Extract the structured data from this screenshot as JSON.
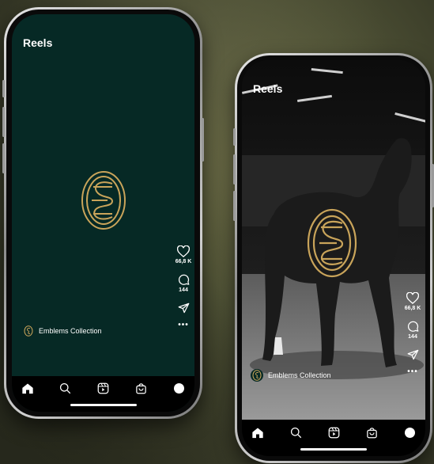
{
  "reel_left": {
    "title": "Reels",
    "likes": "66,8 K",
    "comments": "144",
    "account_name": "Emblems Collection",
    "more": "•••"
  },
  "reel_right": {
    "title": "Reels",
    "likes": "66,8 K",
    "comments": "144",
    "account_name": "Emblems Collection",
    "more": "•••"
  },
  "icons": {
    "like": "heart-icon",
    "comment": "comment-icon",
    "share": "send-icon",
    "more": "more-icon",
    "nav": [
      "home-icon",
      "search-icon",
      "reels-icon",
      "shop-icon",
      "profile-icon"
    ]
  },
  "colors": {
    "screen_green": "#062925",
    "gold": "#c9a45a",
    "nav_bg": "#000000"
  }
}
